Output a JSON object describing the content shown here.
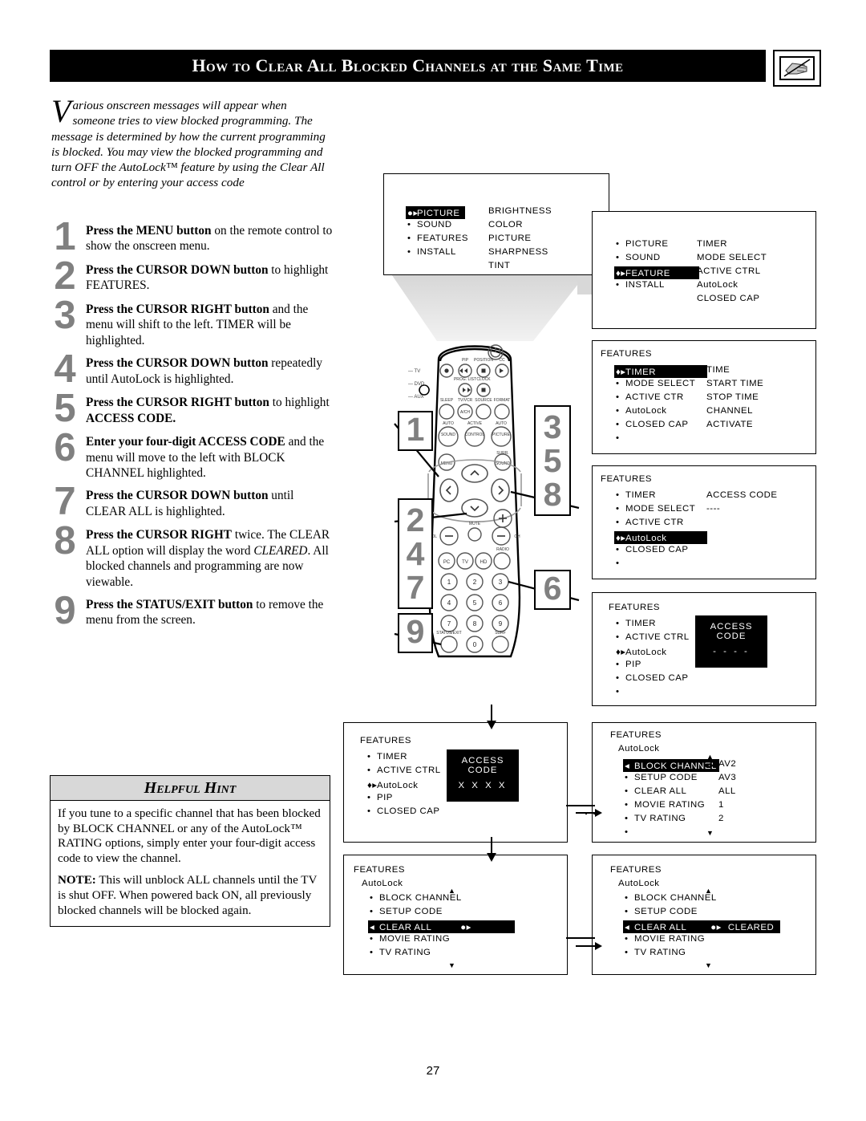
{
  "header": {
    "title": "How to Clear All Blocked Channels at the Same Time",
    "icon": "hand-pointing-icon"
  },
  "intro": {
    "dropcap": "V",
    "text": "arious onscreen messages will appear when someone tries to view blocked programming. The message is determined by how the current programming is blocked. You may view the blocked programming and turn OFF the AutoLock™ feature by using the Clear All control or by entering your access code"
  },
  "steps": [
    {
      "num": "1",
      "bold": "Press the MENU button",
      "rest": " on the remote control to show the onscreen menu."
    },
    {
      "num": "2",
      "bold": "Press the CURSOR DOWN button",
      "rest": " to highlight FEATURES."
    },
    {
      "num": "3",
      "bold": "Press the CURSOR RIGHT button",
      "rest": " and the menu will shift to the left. TIMER will be highlighted."
    },
    {
      "num": "4",
      "bold": "Press the CURSOR DOWN button",
      "rest": " repeatedly until AutoLock is highlighted."
    },
    {
      "num": "5",
      "bold": "Press the CURSOR RIGHT button",
      "rest": " to highlight ",
      "bold2": "ACCESS CODE."
    },
    {
      "num": "6",
      "bold": "Enter your four-digit ACCESS CODE",
      "rest": " and the menu will move to the left with BLOCK CHANNEL highlighted."
    },
    {
      "num": "7",
      "bold": "Press the CURSOR DOWN button",
      "rest": " until CLEAR ALL is highlighted."
    },
    {
      "num": "8",
      "bold": "Press the CURSOR RIGHT",
      "rest": " twice. The CLEAR ALL option will display the word ",
      "italic": "CLEARED",
      "rest2": ". All blocked channels and programming are now viewable."
    },
    {
      "num": "9",
      "bold": "Press the STATUS/EXIT button",
      "rest": " to remove the menu from the screen."
    }
  ],
  "hint": {
    "title": "Helpful Hint",
    "paragraph1": "If you tune to a specific channel that has been blocked by BLOCK CHANNEL or any of the AutoLock™ RATING options, simply enter your four-digit access code to view the channel.",
    "note_label": "NOTE:",
    "paragraph2": " This will unblock ALL channels until the TV is shut OFF. When powered back ON, all previously blocked channels will be blocked again."
  },
  "page_number": "27",
  "menus": {
    "m1": {
      "left": [
        {
          "label": "PICTURE",
          "marker": "cursor",
          "highlighted": true
        },
        {
          "label": "SOUND",
          "marker": "bullet",
          "highlighted": false
        },
        {
          "label": "FEATURES",
          "marker": "bullet",
          "highlighted": false
        },
        {
          "label": "INSTALL",
          "marker": "bullet",
          "highlighted": false
        }
      ],
      "right": [
        "BRIGHTNESS",
        "COLOR",
        "PICTURE",
        "SHARPNESS",
        "TINT"
      ]
    },
    "m2": {
      "left": [
        {
          "label": "PICTURE",
          "marker": "bullet",
          "highlighted": false
        },
        {
          "label": "SOUND",
          "marker": "bullet",
          "highlighted": false
        },
        {
          "label": "FEATURE",
          "marker": "cursor",
          "highlighted": true
        },
        {
          "label": "INSTALL",
          "marker": "bullet",
          "highlighted": false
        }
      ],
      "right": [
        "TIMER",
        "MODE SELECT",
        "ACTIVE CTRL",
        "AutoLock",
        "CLOSED CAP"
      ]
    },
    "m3": {
      "title": "FEATURES",
      "left": [
        {
          "label": "TIMER",
          "marker": "cursor",
          "highlighted": true
        },
        {
          "label": "MODE SELECT",
          "marker": "bullet",
          "highlighted": false
        },
        {
          "label": "ACTIVE CTR",
          "marker": "bullet",
          "highlighted": false
        },
        {
          "label": "AutoLock",
          "marker": "bullet",
          "highlighted": false
        },
        {
          "label": "CLOSED CAP",
          "marker": "bullet",
          "highlighted": false
        },
        {
          "label": "",
          "marker": "bullet",
          "highlighted": false
        }
      ],
      "right": [
        "TIME",
        "START TIME",
        "STOP TIME",
        "CHANNEL",
        "ACTIVATE"
      ]
    },
    "m4": {
      "title": "FEATURES",
      "left": [
        {
          "label": "TIMER",
          "marker": "bullet",
          "highlighted": false
        },
        {
          "label": "MODE SELECT",
          "marker": "bullet",
          "highlighted": false
        },
        {
          "label": "ACTIVE CTR",
          "marker": "bullet",
          "highlighted": false
        },
        {
          "label": "AutoLock",
          "marker": "cursor",
          "highlighted": true
        },
        {
          "label": "CLOSED CAP",
          "marker": "bullet",
          "highlighted": false
        },
        {
          "label": "",
          "marker": "bullet",
          "highlighted": false
        }
      ],
      "right": [
        "ACCESS CODE",
        "----"
      ]
    },
    "m5": {
      "title": "FEATURES",
      "left": [
        {
          "label": "TIMER",
          "marker": "bullet",
          "highlighted": false
        },
        {
          "label": "ACTIVE CTRL",
          "marker": "bullet",
          "highlighted": false
        },
        {
          "label": "AutoLock",
          "marker": "cursor",
          "highlighted": false
        },
        {
          "label": "PIP",
          "marker": "bullet",
          "highlighted": false
        },
        {
          "label": "CLOSED CAP",
          "marker": "bullet",
          "highlighted": false
        },
        {
          "label": "",
          "marker": "bullet",
          "highlighted": false
        }
      ],
      "box": {
        "line1": "ACCESS CODE",
        "line2": "- - - -"
      }
    },
    "m6": {
      "title": "FEATURES",
      "subtitle": "AutoLock",
      "left": [
        {
          "label": "BLOCK CHANNEL",
          "marker": "left-arrow",
          "highlighted": true
        },
        {
          "label": "SETUP CODE",
          "marker": "bullet",
          "highlighted": false
        },
        {
          "label": "CLEAR ALL",
          "marker": "bullet",
          "highlighted": false
        },
        {
          "label": "MOVIE RATING",
          "marker": "bullet",
          "highlighted": false
        },
        {
          "label": "TV RATING",
          "marker": "bullet",
          "highlighted": false
        },
        {
          "label": "",
          "marker": "bullet",
          "highlighted": false
        }
      ],
      "right": [
        "AV2",
        "AV3",
        "ALL",
        "1",
        "2"
      ],
      "value_marker": "●▸",
      "scroll_up": "▲",
      "scroll_down": "▼"
    },
    "m7": {
      "title": "FEATURES",
      "left": [
        {
          "label": "TIMER",
          "marker": "bullet",
          "highlighted": false
        },
        {
          "label": "ACTIVE CTRL",
          "marker": "bullet",
          "highlighted": false
        },
        {
          "label": "AutoLock",
          "marker": "cursor",
          "highlighted": false
        },
        {
          "label": "PIP",
          "marker": "bullet",
          "highlighted": false
        },
        {
          "label": "CLOSED CAP",
          "marker": "bullet",
          "highlighted": false
        }
      ],
      "box": {
        "line1": "ACCESS CODE",
        "line2": "X X X X"
      }
    },
    "m8": {
      "title": "FEATURES",
      "subtitle": "AutoLock",
      "left": [
        {
          "label": "BLOCK CHANNEL",
          "marker": "bullet",
          "highlighted": false
        },
        {
          "label": "SETUP CODE",
          "marker": "bullet",
          "highlighted": false
        },
        {
          "label": "CLEAR ALL",
          "marker": "left-arrow",
          "highlighted": true,
          "value_marker": "●▸"
        },
        {
          "label": "MOVIE RATING",
          "marker": "bullet",
          "highlighted": false
        },
        {
          "label": "TV RATING",
          "marker": "bullet",
          "highlighted": false
        }
      ],
      "scroll_up": "▲",
      "scroll_down": "▼"
    },
    "m9": {
      "title": "FEATURES",
      "subtitle": "AutoLock",
      "left": [
        {
          "label": "BLOCK CHANNEL",
          "marker": "bullet",
          "highlighted": false
        },
        {
          "label": "SETUP CODE",
          "marker": "bullet",
          "highlighted": false
        },
        {
          "label": "CLEAR ALL",
          "marker": "left-arrow",
          "highlighted": true,
          "value_marker": "●▸",
          "value": "CLEARED"
        },
        {
          "label": "MOVIE RATING",
          "marker": "bullet",
          "highlighted": false
        },
        {
          "label": "TV RATING",
          "marker": "bullet",
          "highlighted": false
        }
      ],
      "scroll_up": "▲",
      "scroll_down": "▼"
    }
  },
  "remote": {
    "callouts": [
      {
        "id": "callout-1",
        "values": [
          "1"
        ]
      },
      {
        "id": "callout-358",
        "values": [
          "3",
          "5",
          "8"
        ]
      },
      {
        "id": "callout-247",
        "values": [
          "2",
          "4",
          "7"
        ]
      },
      {
        "id": "callout-6",
        "values": [
          "6"
        ]
      },
      {
        "id": "callout-9",
        "values": [
          "9"
        ]
      }
    ],
    "side_labels": [
      "TV",
      "DVD",
      "AUX"
    ],
    "button_labels": {
      "pip": "PIP",
      "position": "POSITION",
      "cc": "CC",
      "prog_list": "PROG. LIST",
      "clock": "CLOCK",
      "sleep": "SLEEP",
      "tv_vcr": "TV/VCR",
      "source": "SOURCE",
      "format": "FORMAT",
      "a_ch": "A/CH",
      "auto_sound": "AUTO SOUND",
      "active_control": "ACTIVE CONTROL",
      "auto_picture": "AUTO PICTURE",
      "menu": "MENU",
      "surr_sound": "SURR. SOUND",
      "vol": "VOL",
      "mute": "MUTE",
      "ch": "CH",
      "pc": "PC",
      "tv": "TV",
      "hd": "HD",
      "radio": "RADIO",
      "status_exit": "STATUS/EXIT",
      "surf": "SURF"
    },
    "keypad": [
      "1",
      "2",
      "3",
      "4",
      "5",
      "6",
      "7",
      "8",
      "9",
      "0"
    ]
  }
}
